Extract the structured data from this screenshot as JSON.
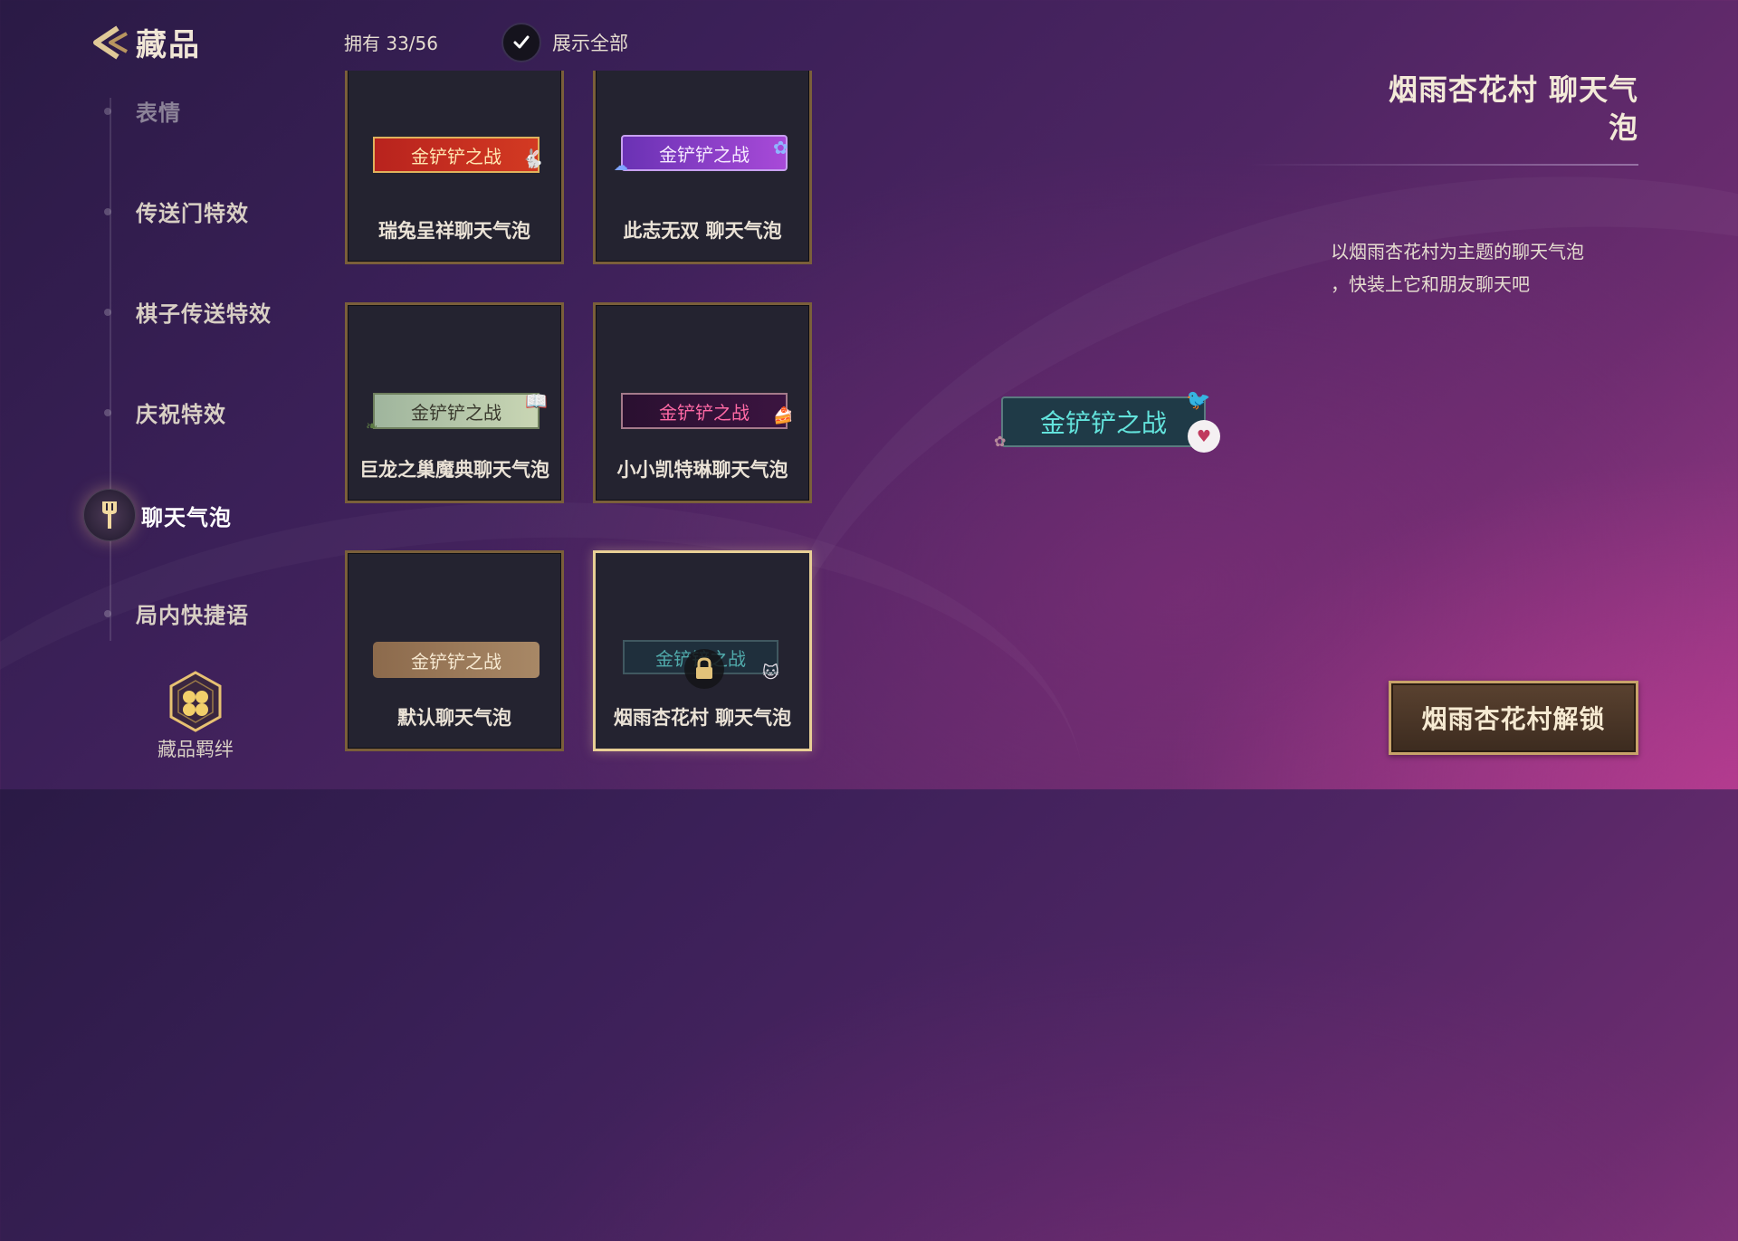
{
  "header": {
    "title": "藏品",
    "owned": "拥有 33/56",
    "show_all_label": "展示全部",
    "show_all_checked": true
  },
  "nav": {
    "items": [
      {
        "label": "表情",
        "state": "dim"
      },
      {
        "label": "传送门特效",
        "state": "normal"
      },
      {
        "label": "棋子传送特效",
        "state": "normal"
      },
      {
        "label": "庆祝特效",
        "state": "normal"
      },
      {
        "label": "聊天气泡",
        "state": "active"
      },
      {
        "label": "局内快捷语",
        "state": "normal"
      }
    ],
    "bond_label": "藏品羁绊"
  },
  "grid": {
    "items": [
      {
        "name": "瑞兔呈祥聊天气泡",
        "bubble_text": "金铲铲之战",
        "style": "red",
        "locked": false
      },
      {
        "name": "此志无双  聊天气泡",
        "bubble_text": "金铲铲之战",
        "style": "purple",
        "locked": false
      },
      {
        "name": "巨龙之巢魔典聊天气泡",
        "bubble_text": "金铲铲之战",
        "style": "green",
        "locked": false
      },
      {
        "name": "小小凯特琳聊天气泡",
        "bubble_text": "金铲铲之战",
        "style": "dark",
        "locked": false
      },
      {
        "name": "默认聊天气泡",
        "bubble_text": "金铲铲之战",
        "style": "brown",
        "locked": false
      },
      {
        "name": "烟雨杏花村  聊天气泡",
        "bubble_text": "金铲铲之战",
        "style": "teal",
        "locked": true,
        "selected": true
      }
    ]
  },
  "detail": {
    "title_line1": "烟雨杏花村  聊天气",
    "title_line2": "泡",
    "desc_line1": "以烟雨杏花村为主题的聊天气泡",
    "desc_line2": "，快装上它和朋友聊天吧",
    "preview_text": "金铲铲之战",
    "unlock_label": "烟雨杏花村解锁"
  },
  "colors": {
    "accent_gold": "#c8a36a",
    "bg_purple": "#3b2058",
    "bg_pink": "#9a3a86",
    "preview_text": "#63e3dc"
  },
  "icons": [
    "back-arrow-icon",
    "checkmark-icon",
    "spatula-icon",
    "hexagon-bond-icon",
    "lock-icon"
  ]
}
